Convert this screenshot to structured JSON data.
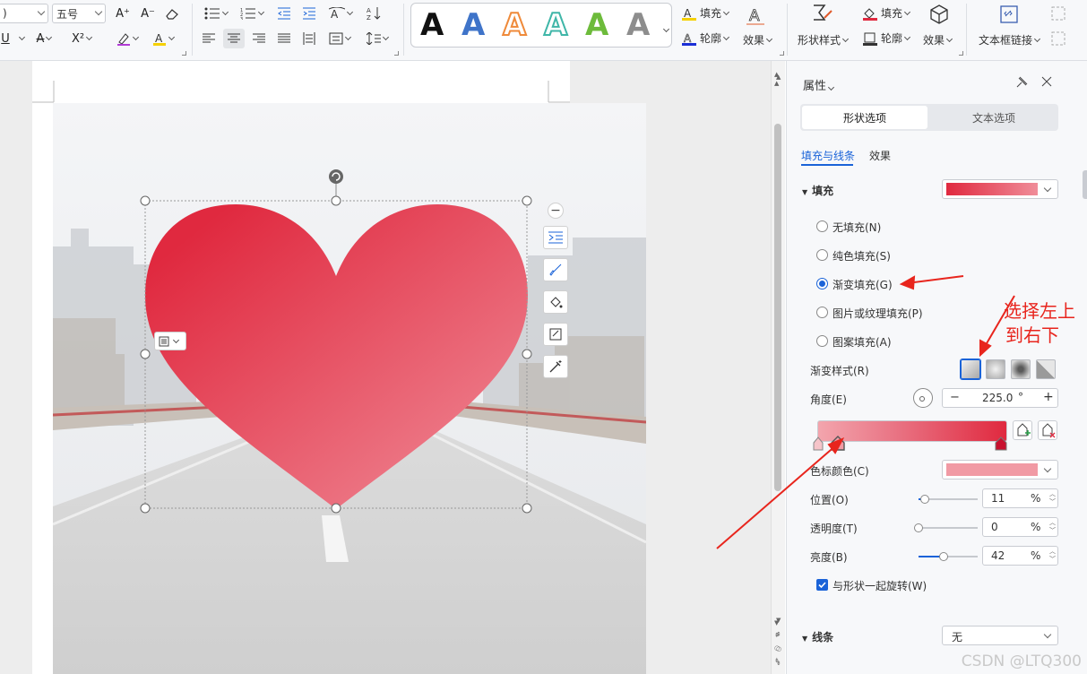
{
  "ribbon": {
    "font_name_value": ")",
    "font_size_value": "五号",
    "grow_font": "A⁺",
    "shrink_font": "A⁻",
    "superscript": "X²",
    "art_letter": "A",
    "text_fill_label": "填充",
    "text_outline_label": "轮廓",
    "text_effect_label": "效果",
    "shape_style_label": "形状样式",
    "shape_fill_label": "填充",
    "shape_outline_label": "轮廓",
    "shape_effect_label": "效果",
    "textbox_link_label": "文本框链接"
  },
  "panel": {
    "title": "属性",
    "tabs": [
      "形状选项",
      "文本选项"
    ],
    "active_tab": "形状选项",
    "subtabs": [
      "填充与线条",
      "效果"
    ],
    "active_subtab": "填充与线条",
    "fill_section": "填充",
    "fill_options": [
      "无填充(N)",
      "纯色填充(S)",
      "渐变填充(G)",
      "图片或纹理填充(P)",
      "图案填充(A)"
    ],
    "selected_fill": "渐变填充(G)",
    "gradient_style_label": "渐变样式(R)",
    "angle_label": "角度(E)",
    "angle_value": "225.0",
    "angle_unit": "°",
    "stop_color_label": "色标颜色(C)",
    "position_label": "位置(O)",
    "position_value": "11",
    "transparency_label": "透明度(T)",
    "transparency_value": "0",
    "brightness_label": "亮度(B)",
    "brightness_value": "42",
    "percent": "%",
    "rotate_with_shape_label": "与形状一起旋转(W)",
    "rotate_with_shape_checked": true,
    "line_section": "线条",
    "line_value": "无",
    "minus": "−",
    "plus": "+"
  },
  "levels": {
    "position_pct": 11,
    "transparency_pct": 0,
    "brightness_pct": 42
  },
  "colors": {
    "gradient_start": "#e0293f",
    "gradient_end": "#f08d99",
    "stop_color": "#f19aa4",
    "accent_blue": "#1a63d8",
    "annotation_red": "#e8251d"
  },
  "annotation": {
    "line1": "选择左上",
    "line2": "到右下"
  },
  "watermark": "CSDN @LTQ300"
}
